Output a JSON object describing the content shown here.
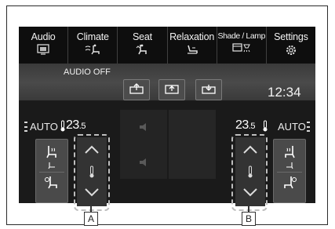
{
  "tabs": [
    {
      "label": "Audio",
      "icon": "screen-icon"
    },
    {
      "label": "Climate",
      "icon": "climate-seat-icon"
    },
    {
      "label": "Seat",
      "icon": "seat-icon"
    },
    {
      "label": "Relaxation",
      "icon": "relaxation-seat-icon"
    },
    {
      "label": "Shade / Lamp",
      "icon": "shade-lamp-icon"
    },
    {
      "label": "Settings",
      "icon": "gear-icon"
    }
  ],
  "status": {
    "audio": "AUDIO OFF",
    "time": "12:34"
  },
  "climate": {
    "left": {
      "mode": "AUTO",
      "temp_int": "23",
      "temp_dec": ".5"
    },
    "right": {
      "mode": "AUTO",
      "temp_int": "23",
      "temp_dec": ".5"
    }
  },
  "callouts": {
    "left": "A",
    "right": "B"
  },
  "colors": {
    "screen": "#1c1c1c",
    "tabbar": "#0e0e0e",
    "button": "#4a4a4a",
    "text": "#f2f2f2"
  }
}
